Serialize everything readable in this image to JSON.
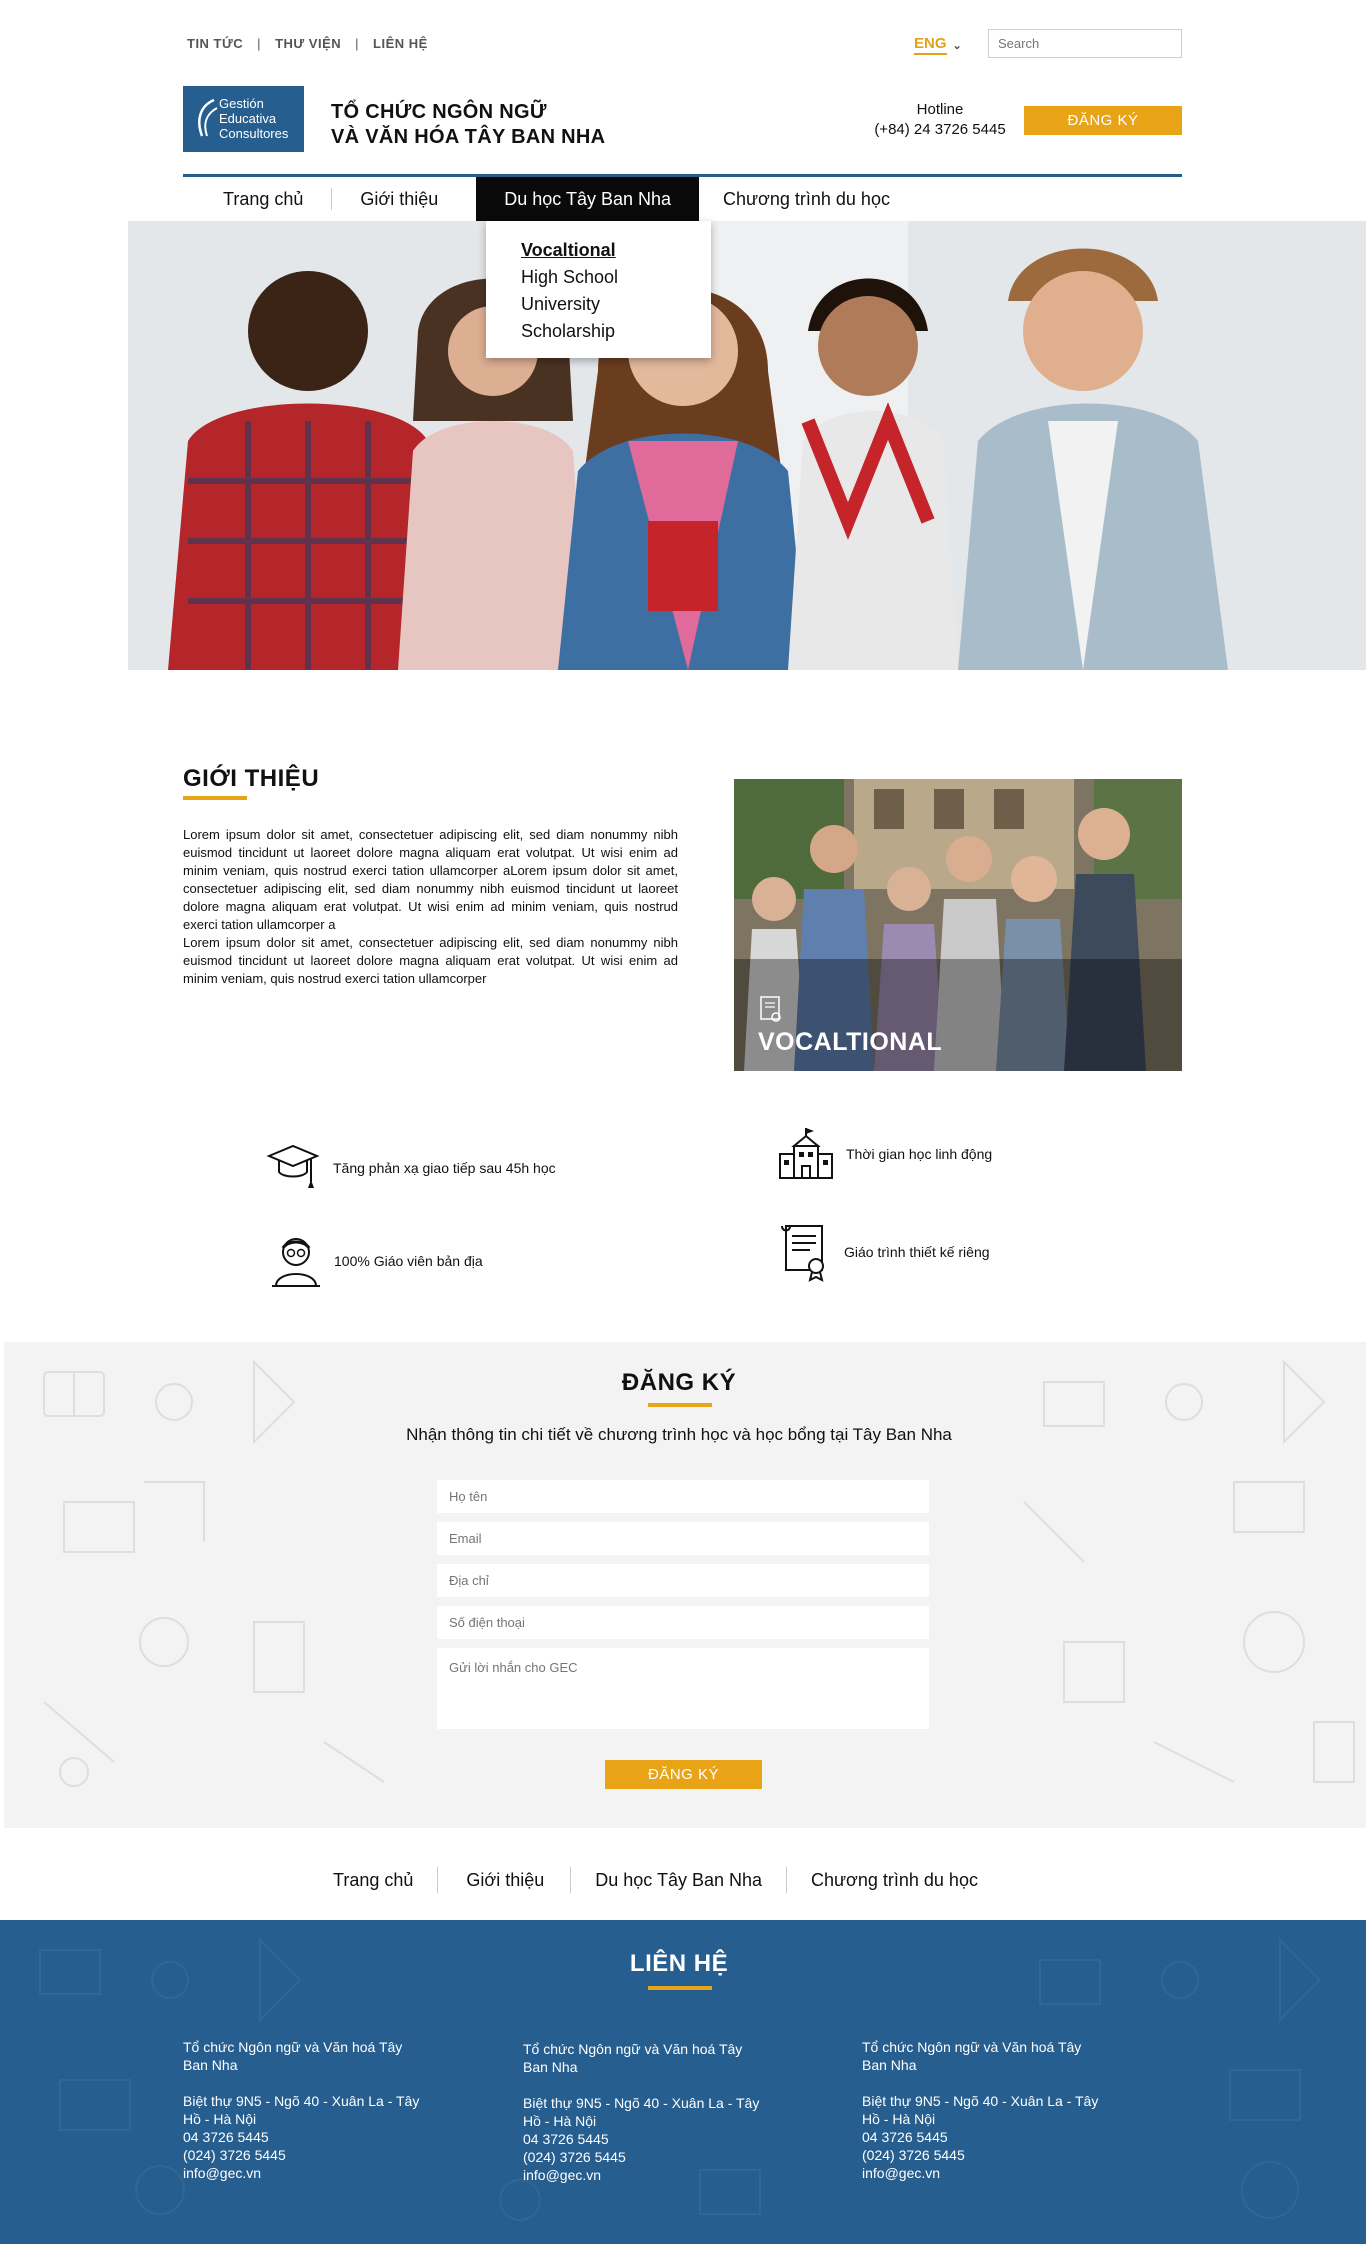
{
  "top_links": [
    "TIN TỨC",
    "THƯ VIỆN",
    "LIÊN HỆ"
  ],
  "lang": "ENG",
  "search_placeholder": "Search",
  "logo": {
    "line1": "Gestión",
    "line2": "Educativa",
    "line3": "Consultores"
  },
  "org": {
    "line1": "TỔ CHỨC NGÔN NGỮ",
    "line2": "VÀ VĂN HÓA TÂY BAN NHA"
  },
  "hotline": {
    "label": "Hotline",
    "number": "(+84) 24 3726 5445"
  },
  "register_button": "ĐĂNG KÝ",
  "nav": [
    "Trang chủ",
    "Giới thiệu",
    "Du học Tây Ban Nha",
    "Chương trình du học"
  ],
  "dropdown": [
    "Vocaltional",
    "High School",
    "University",
    "Scholarship"
  ],
  "intro": {
    "title": "GIỚI THIỆU",
    "para1": "Lorem ipsum dolor sit amet, consectetuer adipiscing elit, sed diam nonummy nibh euismod tincidunt ut laoreet dolore magna aliquam erat volutpat. Ut wisi enim ad minim veniam, quis nostrud exerci tation ullamcorper aLorem ipsum dolor sit amet, consectetuer adipiscing elit, sed diam nonummy nibh euismod tincidunt ut laoreet dolore magna aliquam erat volutpat. Ut wisi enim ad minim veniam, quis nostrud exerci tation ullamcorper a",
    "para2": "Lorem ipsum dolor sit amet, consectetuer adipiscing elit, sed diam nonummy nibh euismod tincidunt ut laoreet dolore magna aliquam erat volutpat. Ut wisi enim ad minim veniam, quis nostrud exerci tation ullamcorper",
    "image_caption": "VOCALTIONAL"
  },
  "features": [
    "Tăng phản xạ giao tiếp sau 45h học",
    "Thời gian học linh động",
    "100% Giáo viên bản địa",
    "Giáo trình thiết kế riêng"
  ],
  "register": {
    "title": "ĐĂNG KÝ",
    "subtitle": "Nhận thông tin chi tiết về chương trình học và học bổng tại Tây Ban Nha",
    "fields": [
      "Họ tên",
      "Email",
      "Địa chỉ",
      "Số điện thoại"
    ],
    "message_placeholder": "Gửi lời nhắn cho GEC",
    "button": "ĐĂNG KÝ"
  },
  "footer_nav": [
    "Trang chủ",
    "Giới thiệu",
    "Du học Tây Ban Nha",
    "Chương trình du học"
  ],
  "contact": {
    "title": "LIÊN HỆ",
    "columns": [
      {
        "name": "Tổ chức Ngôn ngữ và Văn hoá Tây Ban Nha",
        "address": "Biệt thự 9N5 - Ngõ 40 - Xuân La - Tây Hồ - Hà Nội",
        "phone1": "04 3726 5445",
        "phone2": "(024) 3726 5445",
        "email": "info@gec.vn"
      },
      {
        "name": "Tổ chức Ngôn ngữ và Văn hoá Tây Ban Nha",
        "address": "Biệt thự 9N5 - Ngõ 40 - Xuân La - Tây Hồ - Hà Nội",
        "phone1": "04 3726 5445",
        "phone2": "(024) 3726 5445",
        "email": "info@gec.vn"
      },
      {
        "name": "Tổ chức Ngôn ngữ và Văn hoá Tây Ban Nha",
        "address": "Biệt thự 9N5 - Ngõ 40 - Xuân La - Tây Hồ - Hà Nội",
        "phone1": "04 3726 5445",
        "phone2": "(024) 3726 5445",
        "email": "info@gec.vn"
      }
    ]
  },
  "colors": {
    "brand_blue": "#265e8f",
    "accent_yellow": "#e8a317",
    "nav_active": "#0a0a0a",
    "form_bg": "#f3f3f3"
  }
}
